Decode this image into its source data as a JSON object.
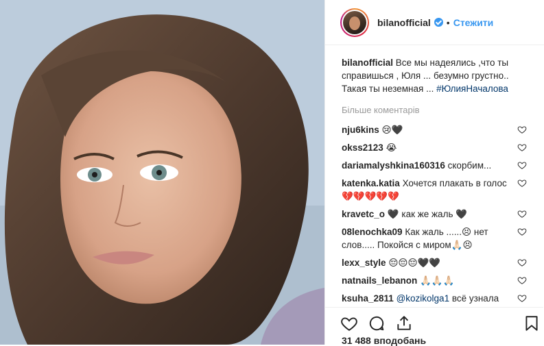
{
  "post": {
    "username": "bilanofficial",
    "follow_label": "Стежити",
    "separator": "•",
    "caption_text": "Все мы надеялись ,что ты справишься , Юля ... безумно грустно.. Такая ты неземная ...",
    "caption_hashtag": "#ЮлияНачалова",
    "more_comments_label": "Більше коментарів",
    "likes_label": "31 488 вподобань"
  },
  "comments": [
    {
      "user": "nju6kins",
      "text": "😢🖤"
    },
    {
      "user": "okss2123",
      "text": "😭"
    },
    {
      "user": "dariamalyshkina160316",
      "text": "скорбим..."
    },
    {
      "user": "katenka.katia",
      "text": "Хочется плакать в голос 💔💔💔💔💔"
    },
    {
      "user": "kravetc_o",
      "text": "🖤 как же жаль 🖤"
    },
    {
      "user": "08lenochka09",
      "text": "Как жаль ......😣 нет слов..... Покойся с миром🙏🏻😣"
    },
    {
      "user": "lexx_style",
      "text": "😔😔😔🖤🖤"
    },
    {
      "user": "natnails_lebanon",
      "text": "🙏🏻🙏🏻🙏🏻"
    },
    {
      "user": "ksuha_2811",
      "mention": "@kozikolga1",
      "text": "всё узнала спасибо 😢"
    },
    {
      "user": "...",
      "text": "... 😢"
    }
  ],
  "icons": {
    "verified": "verified-badge-icon",
    "like": "heart-icon",
    "comment": "comment-icon",
    "share": "share-icon",
    "save": "bookmark-icon"
  },
  "colors": {
    "accent": "#3897f0",
    "hashtag": "#003569",
    "muted": "#999999"
  }
}
